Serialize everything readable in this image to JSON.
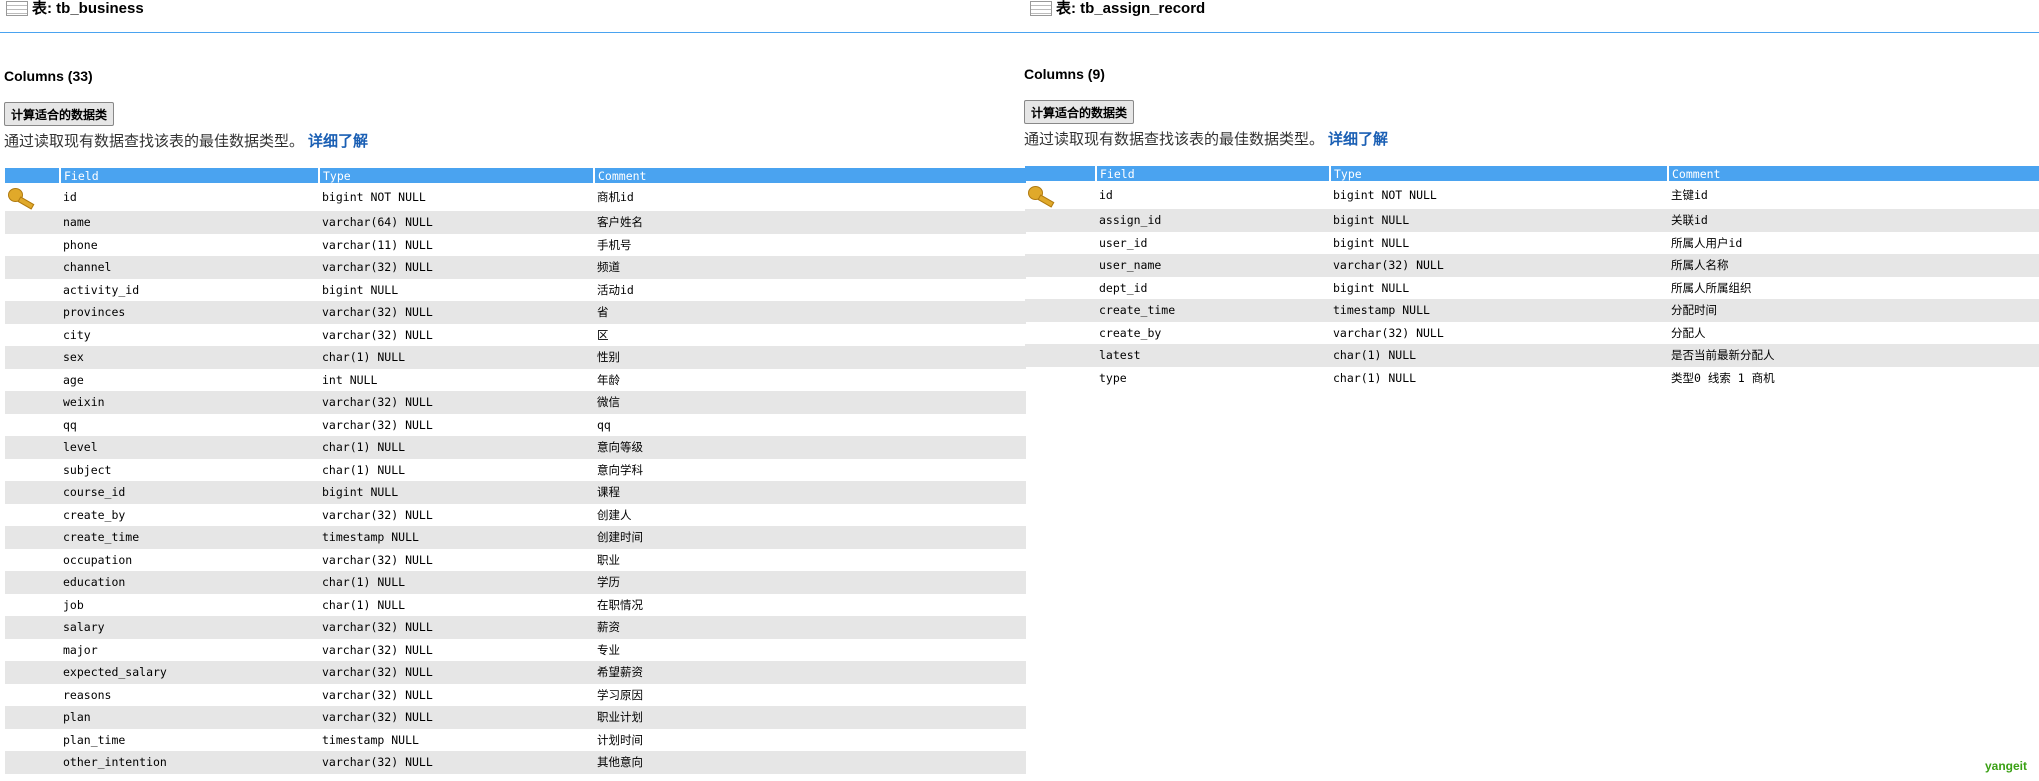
{
  "left": {
    "title": "表: tb_business",
    "columns_count": "Columns (33)",
    "calc_button": "计算适合的数据类",
    "description": "通过读取现有数据查找该表的最佳数据类型。",
    "learn_more": "详细了解",
    "headers": {
      "field": "Field",
      "type": "Type",
      "comment": "Comment"
    },
    "rows": [
      {
        "field": "id",
        "type": "bigint NOT NULL",
        "comment": "商机id",
        "key": true
      },
      {
        "field": "name",
        "type": "varchar(64) NULL",
        "comment": "客户姓名"
      },
      {
        "field": "phone",
        "type": "varchar(11) NULL",
        "comment": "手机号"
      },
      {
        "field": "channel",
        "type": "varchar(32) NULL",
        "comment": "频道"
      },
      {
        "field": "activity_id",
        "type": "bigint NULL",
        "comment": "活动id"
      },
      {
        "field": "provinces",
        "type": "varchar(32) NULL",
        "comment": "省"
      },
      {
        "field": "city",
        "type": "varchar(32) NULL",
        "comment": "区"
      },
      {
        "field": "sex",
        "type": "char(1) NULL",
        "comment": "性别"
      },
      {
        "field": "age",
        "type": "int NULL",
        "comment": "年龄"
      },
      {
        "field": "weixin",
        "type": "varchar(32) NULL",
        "comment": "微信"
      },
      {
        "field": "qq",
        "type": "varchar(32) NULL",
        "comment": "qq"
      },
      {
        "field": "level",
        "type": "char(1) NULL",
        "comment": "意向等级"
      },
      {
        "field": "subject",
        "type": "char(1) NULL",
        "comment": "意向学科"
      },
      {
        "field": "course_id",
        "type": "bigint NULL",
        "comment": "课程"
      },
      {
        "field": "create_by",
        "type": "varchar(32) NULL",
        "comment": "创建人"
      },
      {
        "field": "create_time",
        "type": "timestamp NULL",
        "comment": "创建时间"
      },
      {
        "field": "occupation",
        "type": "varchar(32) NULL",
        "comment": "职业"
      },
      {
        "field": "education",
        "type": "char(1) NULL",
        "comment": "学历"
      },
      {
        "field": "job",
        "type": "char(1) NULL",
        "comment": "在职情况"
      },
      {
        "field": "salary",
        "type": "varchar(32) NULL",
        "comment": "薪资"
      },
      {
        "field": "major",
        "type": "varchar(32) NULL",
        "comment": "专业"
      },
      {
        "field": "expected_salary",
        "type": "varchar(32) NULL",
        "comment": "希望薪资"
      },
      {
        "field": "reasons",
        "type": "varchar(32) NULL",
        "comment": "学习原因"
      },
      {
        "field": "plan",
        "type": "varchar(32) NULL",
        "comment": "职业计划"
      },
      {
        "field": "plan_time",
        "type": "timestamp NULL",
        "comment": "计划时间"
      },
      {
        "field": "other_intention",
        "type": "varchar(32) NULL",
        "comment": "其他意向"
      }
    ]
  },
  "right": {
    "title": "表: tb_assign_record",
    "columns_count": "Columns (9)",
    "calc_button": "计算适合的数据类",
    "description": "通过读取现有数据查找该表的最佳数据类型。",
    "learn_more": "详细了解",
    "headers": {
      "field": "Field",
      "type": "Type",
      "comment": "Comment"
    },
    "rows": [
      {
        "field": "id",
        "type": "bigint NOT NULL",
        "comment": "主键id",
        "key": true
      },
      {
        "field": "assign_id",
        "type": "bigint NULL",
        "comment": "关联id"
      },
      {
        "field": "user_id",
        "type": "bigint NULL",
        "comment": "所属人用户id"
      },
      {
        "field": "user_name",
        "type": "varchar(32) NULL",
        "comment": "所属人名称"
      },
      {
        "field": "dept_id",
        "type": "bigint NULL",
        "comment": "所属人所属组织"
      },
      {
        "field": "create_time",
        "type": "timestamp NULL",
        "comment": "分配时间"
      },
      {
        "field": "create_by",
        "type": "varchar(32) NULL",
        "comment": "分配人"
      },
      {
        "field": "latest",
        "type": "char(1) NULL",
        "comment": "是否当前最新分配人"
      },
      {
        "field": "type",
        "type": "char(1) NULL",
        "comment": "类型0 线索 1 商机"
      }
    ]
  },
  "brand": "yangeit",
  "icons": {
    "table": "table-icon",
    "key": "primary-key-icon"
  },
  "colors": {
    "header_bg": "#4aa3f0",
    "row_alt": "#e6e6e6",
    "link": "#1a5fb4",
    "brand": "#3aa014"
  }
}
